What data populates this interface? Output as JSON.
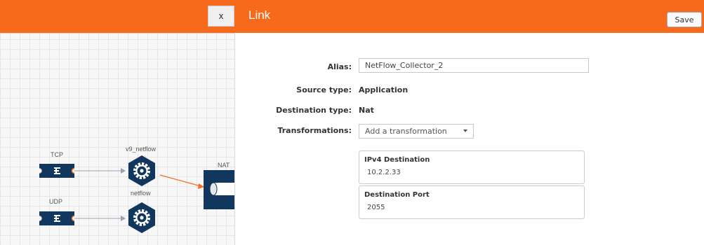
{
  "canvas": {
    "close_label": "x",
    "nodes": [
      {
        "id": "tcp",
        "label": "TCP"
      },
      {
        "id": "udp",
        "label": "UDP"
      },
      {
        "id": "v9_netflow",
        "label": "v9_netflow"
      },
      {
        "id": "netflow",
        "label": "netflow"
      },
      {
        "id": "nat",
        "label": "NAT"
      }
    ],
    "link_color": "#f76a1c"
  },
  "dialog": {
    "title": "Link",
    "save_label": "Save",
    "alias_label": "Alias:",
    "alias_value": "NetFlow_Collector_2",
    "source_type_label": "Source type:",
    "source_type_value": "Application",
    "destination_type_label": "Destination type:",
    "destination_type_value": "Nat",
    "transformations_label": "Transformations:",
    "transformations_placeholder": "Add a transformation",
    "cards": [
      {
        "label": "IPv4 Destination",
        "value": "10.2.2.33"
      },
      {
        "label": "Destination Port",
        "value": "2055"
      }
    ]
  },
  "colors": {
    "accent": "#f76a1c",
    "node": "#12375e"
  }
}
